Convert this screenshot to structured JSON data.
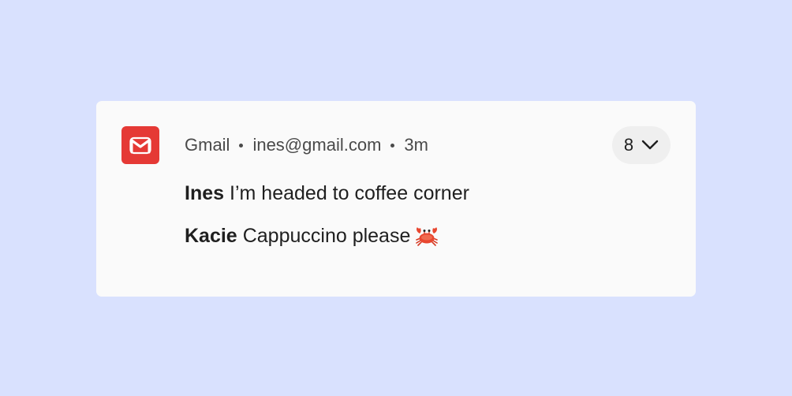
{
  "notification": {
    "app_icon": "gmail-icon",
    "app_color": "#e53935",
    "app_name": "Gmail",
    "account": "ines@gmail.com",
    "time": "3m",
    "count": "8",
    "expand_icon": "chevron-down-icon",
    "messages": [
      {
        "sender": "Ines",
        "text": "I’m headed to coffee corner"
      },
      {
        "sender": "Kacie",
        "text": "Cappuccino please",
        "emoji": "crab-emoji"
      }
    ]
  },
  "colors": {
    "background": "#d9e1fe",
    "card": "#fafafa",
    "pill": "#efefef"
  }
}
